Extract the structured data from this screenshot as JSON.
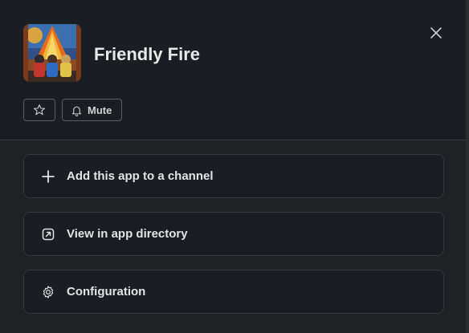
{
  "app": {
    "name": "Friendly Fire",
    "icon": "friendly-fire-app-icon"
  },
  "header_buttons": {
    "star_icon": "star-icon",
    "mute_label": "Mute",
    "mute_icon": "bell-icon",
    "close_icon": "close-icon"
  },
  "actions": [
    {
      "label": "Add this app to a channel",
      "icon": "plus-icon"
    },
    {
      "label": "View in app directory",
      "icon": "external-link-icon"
    },
    {
      "label": "Configuration",
      "icon": "gear-icon"
    }
  ],
  "colors": {
    "background": "#1a1d21",
    "border": "#35373b",
    "text": "#d1d2d3"
  }
}
